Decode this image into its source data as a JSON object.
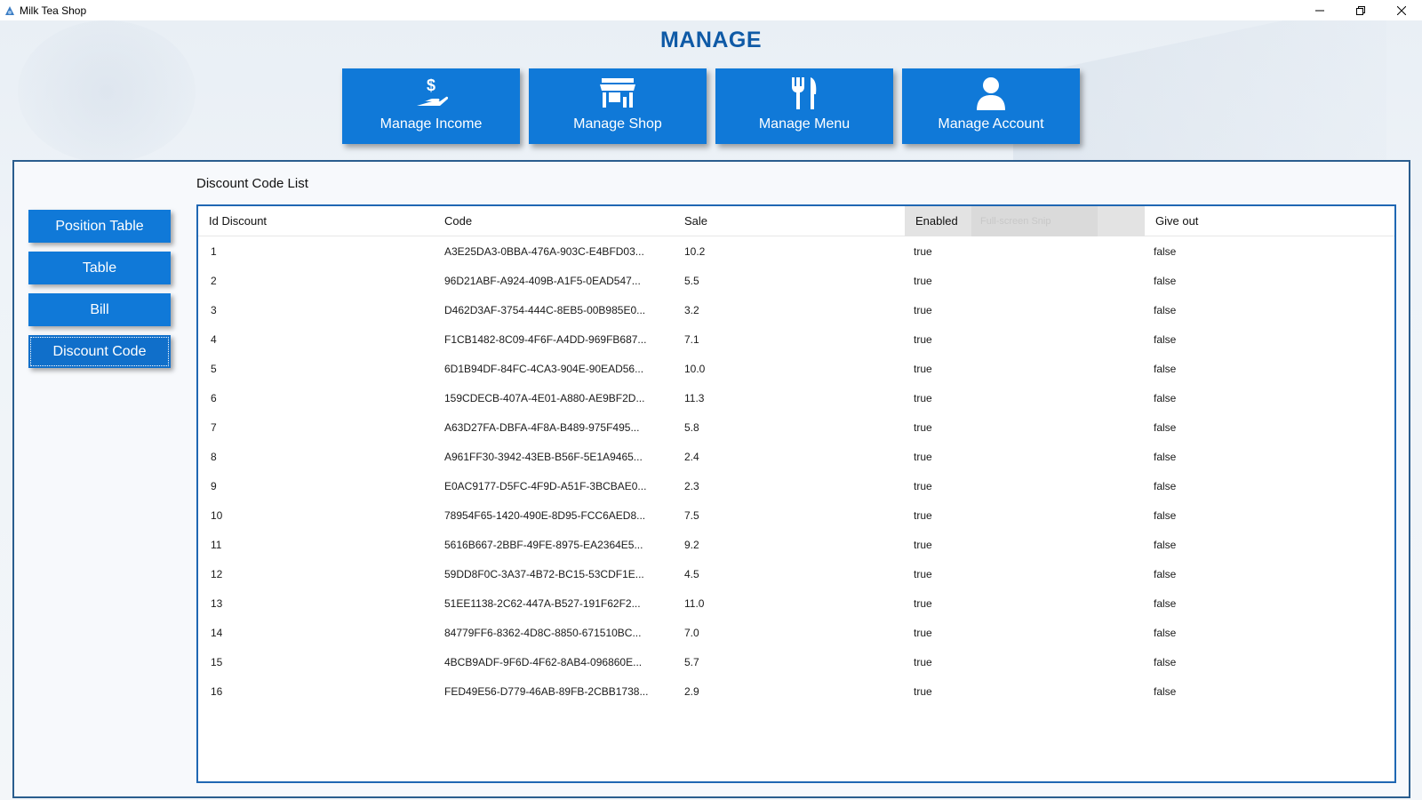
{
  "window": {
    "title": "Milk Tea Shop",
    "controls": [
      "minimize-icon",
      "restore-icon",
      "close-icon"
    ]
  },
  "header": {
    "title": "MANAGE"
  },
  "nav_cards": [
    {
      "label": "Manage Income",
      "icon": "money-hand-icon"
    },
    {
      "label": "Manage Shop",
      "icon": "shop-icon"
    },
    {
      "label": "Manage Menu",
      "icon": "fork-knife-icon"
    },
    {
      "label": "Manage Account",
      "icon": "user-icon"
    }
  ],
  "sidebar": {
    "items": [
      {
        "label": "Position Table"
      },
      {
        "label": "Table"
      },
      {
        "label": "Bill"
      },
      {
        "label": "Discount Code",
        "active": true
      }
    ]
  },
  "list": {
    "title": "Discount Code List",
    "overlay_text": "Full-screen Snip",
    "columns": [
      "Id Discount",
      "Code",
      "Sale",
      "Enabled",
      "Give out"
    ],
    "rows": [
      [
        "1",
        "A3E25DA3-0BBA-476A-903C-E4BFD03...",
        "10.2",
        "true",
        "false"
      ],
      [
        "2",
        "96D21ABF-A924-409B-A1F5-0EAD547...",
        "5.5",
        "true",
        "false"
      ],
      [
        "3",
        "D462D3AF-3754-444C-8EB5-00B985E0...",
        "3.2",
        "true",
        "false"
      ],
      [
        "4",
        "F1CB1482-8C09-4F6F-A4DD-969FB687...",
        "7.1",
        "true",
        "false"
      ],
      [
        "5",
        "6D1B94DF-84FC-4CA3-904E-90EAD56...",
        "10.0",
        "true",
        "false"
      ],
      [
        "6",
        "159CDECB-407A-4E01-A880-AE9BF2D...",
        "11.3",
        "true",
        "false"
      ],
      [
        "7",
        "A63D27FA-DBFA-4F8A-B489-975F495...",
        "5.8",
        "true",
        "false"
      ],
      [
        "8",
        "A961FF30-3942-43EB-B56F-5E1A9465...",
        "2.4",
        "true",
        "false"
      ],
      [
        "9",
        "E0AC9177-D5FC-4F9D-A51F-3BCBAE0...",
        "2.3",
        "true",
        "false"
      ],
      [
        "10",
        "78954F65-1420-490E-8D95-FCC6AED8...",
        "7.5",
        "true",
        "false"
      ],
      [
        "11",
        "5616B667-2BBF-49FE-8975-EA2364E5...",
        "9.2",
        "true",
        "false"
      ],
      [
        "12",
        "59DD8F0C-3A37-4B72-BC15-53CDF1E...",
        "4.5",
        "true",
        "false"
      ],
      [
        "13",
        "51EE1138-2C62-447A-B527-191F62F2...",
        "11.0",
        "true",
        "false"
      ],
      [
        "14",
        "84779FF6-8362-4D8C-8850-671510BC...",
        "7.0",
        "true",
        "false"
      ],
      [
        "15",
        "4BCB9ADF-9F6D-4F62-8AB4-096860E...",
        "5.7",
        "true",
        "false"
      ],
      [
        "16",
        "FED49E56-D779-46AB-89FB-2CBB1738...",
        "2.9",
        "true",
        "false"
      ]
    ]
  }
}
